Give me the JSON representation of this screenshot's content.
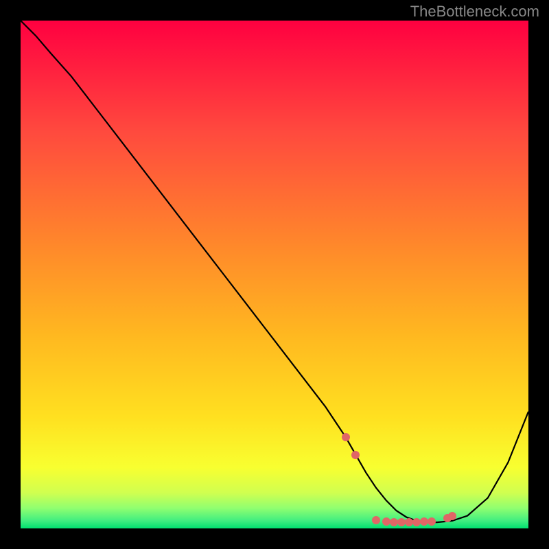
{
  "watermark": "TheBottleneck.com",
  "gradient_stops": [
    {
      "offset": 0,
      "color": "#ff0040"
    },
    {
      "offset": 22,
      "color": "#ff4a3e"
    },
    {
      "offset": 45,
      "color": "#ff8a2a"
    },
    {
      "offset": 62,
      "color": "#ffb820"
    },
    {
      "offset": 78,
      "color": "#ffe020"
    },
    {
      "offset": 88,
      "color": "#f8ff30"
    },
    {
      "offset": 93,
      "color": "#d0ff50"
    },
    {
      "offset": 96,
      "color": "#90ff70"
    },
    {
      "offset": 98.5,
      "color": "#40ee80"
    },
    {
      "offset": 100,
      "color": "#00e070"
    }
  ],
  "chart_data": {
    "type": "line",
    "title": "",
    "xlabel": "",
    "ylabel": "",
    "xlim": [
      0,
      100
    ],
    "ylim": [
      0,
      100
    ],
    "series": [
      {
        "name": "curve",
        "x": [
          0,
          3,
          6,
          10,
          15,
          20,
          25,
          30,
          35,
          40,
          45,
          50,
          55,
          60,
          62,
          64,
          66,
          68,
          70,
          72,
          74,
          76,
          78,
          80,
          82,
          85,
          88,
          92,
          96,
          100
        ],
        "y": [
          100,
          97,
          93.5,
          89,
          82.5,
          76,
          69.5,
          63,
          56.5,
          50,
          43.5,
          37,
          30.5,
          24,
          21,
          18,
          14.5,
          11,
          8,
          5.5,
          3.5,
          2.2,
          1.5,
          1.2,
          1.2,
          1.5,
          2.5,
          6,
          13,
          23
        ]
      }
    ],
    "markers": [
      {
        "x": 64,
        "y": 18
      },
      {
        "x": 66,
        "y": 14.5
      },
      {
        "x": 70,
        "y": 1.6
      },
      {
        "x": 72,
        "y": 1.3
      },
      {
        "x": 73.5,
        "y": 1.2
      },
      {
        "x": 75,
        "y": 1.2
      },
      {
        "x": 76.5,
        "y": 1.2
      },
      {
        "x": 78,
        "y": 1.2
      },
      {
        "x": 79.5,
        "y": 1.3
      },
      {
        "x": 81,
        "y": 1.4
      },
      {
        "x": 84,
        "y": 2.0
      },
      {
        "x": 85,
        "y": 2.5
      }
    ]
  }
}
